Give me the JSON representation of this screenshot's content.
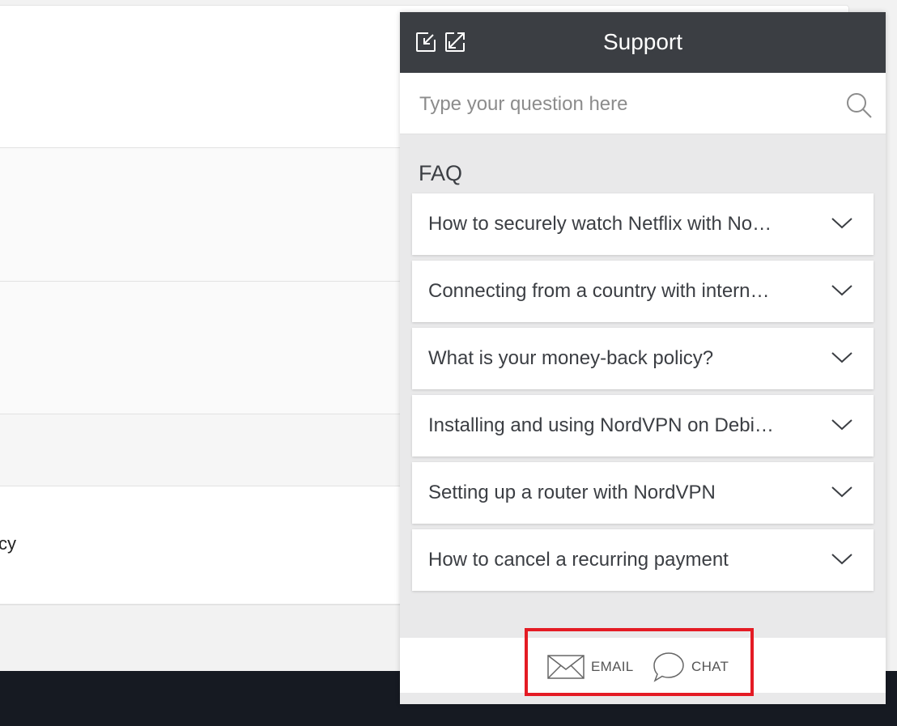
{
  "background": {
    "partial_text": "cy"
  },
  "widget": {
    "title": "Support",
    "search": {
      "placeholder": "Type your question here",
      "value": ""
    },
    "faq_heading": "FAQ",
    "faq_items": [
      {
        "question": "How to securely watch Netflix with No…"
      },
      {
        "question": "Connecting from a country with intern…"
      },
      {
        "question": "What is your money-back policy?"
      },
      {
        "question": "Installing and using NordVPN on Debi…"
      },
      {
        "question": "Setting up a router with NordVPN"
      },
      {
        "question": "How to cancel a recurring payment"
      }
    ],
    "footer": {
      "email_label": "EMAIL",
      "chat_label": "CHAT"
    }
  },
  "colors": {
    "header_bg": "#3b3e43",
    "highlight": "#e41b24",
    "footer_bar": "#161a22"
  },
  "icons": {
    "minimize": "minimize-icon",
    "expand": "expand-icon",
    "search": "search-icon",
    "chevron": "chevron-down-icon",
    "email": "envelope-icon",
    "chat": "chat-bubble-icon"
  }
}
